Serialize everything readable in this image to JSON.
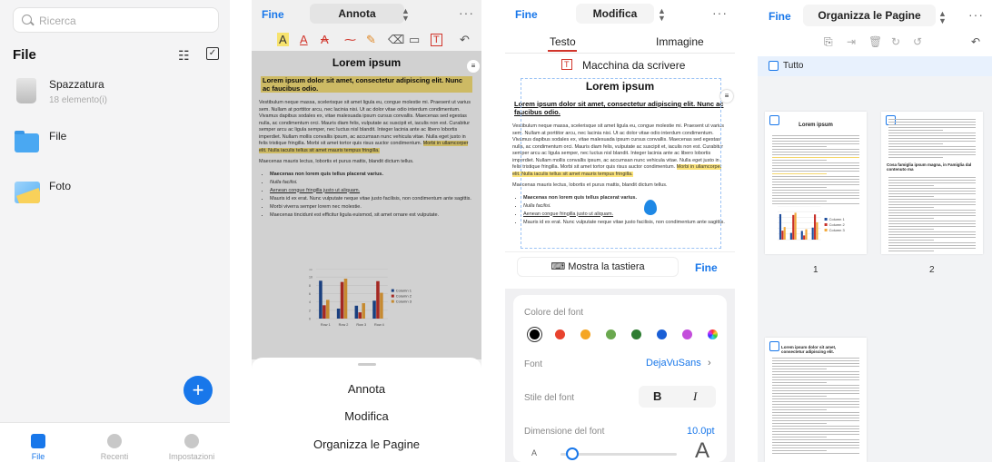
{
  "files_screen": {
    "search_placeholder": "Ricerca",
    "title": "File",
    "items": [
      {
        "name": "Spazzatura",
        "meta": "18 elemento(i)"
      },
      {
        "name": "File",
        "meta": ""
      },
      {
        "name": "Foto",
        "meta": ""
      }
    ],
    "tabs": [
      {
        "label": "File",
        "active": true
      },
      {
        "label": "Recenti",
        "active": false
      },
      {
        "label": "Impostazioni",
        "active": false
      }
    ],
    "fab_label": "+"
  },
  "annotate_screen": {
    "done": "Fine",
    "mode": "Annota",
    "sheet_options": [
      "Annota",
      "Modifica",
      "Organizza le Pagine"
    ]
  },
  "document": {
    "title": "Lorem ipsum",
    "heading": "Lorem ipsum dolor sit amet, consectetur adipiscing elit. Nunc ac faucibus odio.",
    "paragraph": "Vestibulum neque massa, scelerisque sit amet ligula eu, congue molestie mi. Praesent ut varius sem. Nullam at porttitor arcu, nec lacinia nisi. Ut ac dolor vitae odio interdum condimentum. Vivamus dapibus sodales ex, vitae malesuada ipsum cursus convallis. Maecenas sed egestas nulla, ac condimentum orci. Mauris diam felis, vulputate ac suscipit et, iaculis non est. Curabitur semper arcu ac ligula semper, nec luctus nisl blandit. Integer lacinia ante ac libero lobortis imperdiet. Nullam mollis convallis ipsum, ac accumsan nunc vehicula vitae. Nulla eget justo in felis tristique fringilla. Morbi sit amet tortor quis risus auctor condimentum.",
    "highlight": "Morbi in ullamcorper elit. Nulla iaculis tellus sit amet mauris tempus fringilla.",
    "intro": "Maecenas mauris lectus, lobortis et purus mattis, blandit dictum tellus.",
    "bullets": [
      "Maecenas non lorem quis tellus placerat varius.",
      "Nulla facilisi.",
      "Aenean congue fringilla justo ut aliquam.",
      "Mauris id ex erat. Nunc vulputate neque vitae justo facilisis, non condimentum ante sagittis.",
      "Morbi viverra semper lorem nec molestie.",
      "Maecenas tincidunt est efficitur ligula euismod, sit amet ornare est vulputate."
    ]
  },
  "chart_data": {
    "type": "bar",
    "categories": [
      "Row 1",
      "Row 2",
      "Row 3",
      "Row 4"
    ],
    "series": [
      {
        "name": "Column 1",
        "values": [
          9.1,
          2.4,
          3.1,
          4.3
        ],
        "color": "#1f4e9c"
      },
      {
        "name": "Column 2",
        "values": [
          3.2,
          8.8,
          1.5,
          9.0
        ],
        "color": "#c8312a"
      },
      {
        "name": "Column 3",
        "values": [
          4.5,
          9.6,
          3.7,
          6.2
        ],
        "color": "#f2a93b"
      }
    ],
    "ylim": [
      0,
      12
    ],
    "yticks": [
      "0",
      "2",
      "4",
      "6",
      "8",
      "10",
      "12"
    ],
    "legend": "right"
  },
  "edit_screen": {
    "done": "Fine",
    "mode": "Modifica",
    "tabs": [
      "Testo",
      "Immagine"
    ],
    "typewriter": "Macchina da scrivere",
    "show_keyboard": "Mostra la tastiera",
    "keyboard_done": "Fine",
    "font_color_label": "Colore del font",
    "font_colors": [
      "#000000",
      "#e8432e",
      "#f5a623",
      "#6aa84f",
      "#2e7d32",
      "#1a5fd6",
      "#c34ddb",
      "rainbow"
    ],
    "font_label": "Font",
    "font_value": "DejaVuSans",
    "font_style_label": "Stile del font",
    "bold": "B",
    "italic": "I",
    "font_size_label": "Dimensione del font",
    "font_size_value": "10.0pt",
    "size_small": "A",
    "size_large": "A",
    "font_size_slider": 0.05
  },
  "organize_screen": {
    "done": "Fine",
    "mode": "Organizza le Pagine",
    "select_all": "Tutto",
    "pages": [
      "1",
      "2"
    ],
    "page1_title": "Lorem ipsum",
    "page2_title": "Cosa famiglia ipsum magna, in Famiglia dal contenuto ma",
    "page3_title": "Lorem ipsum dolor sit amet, consectetur adipiscing elit."
  }
}
